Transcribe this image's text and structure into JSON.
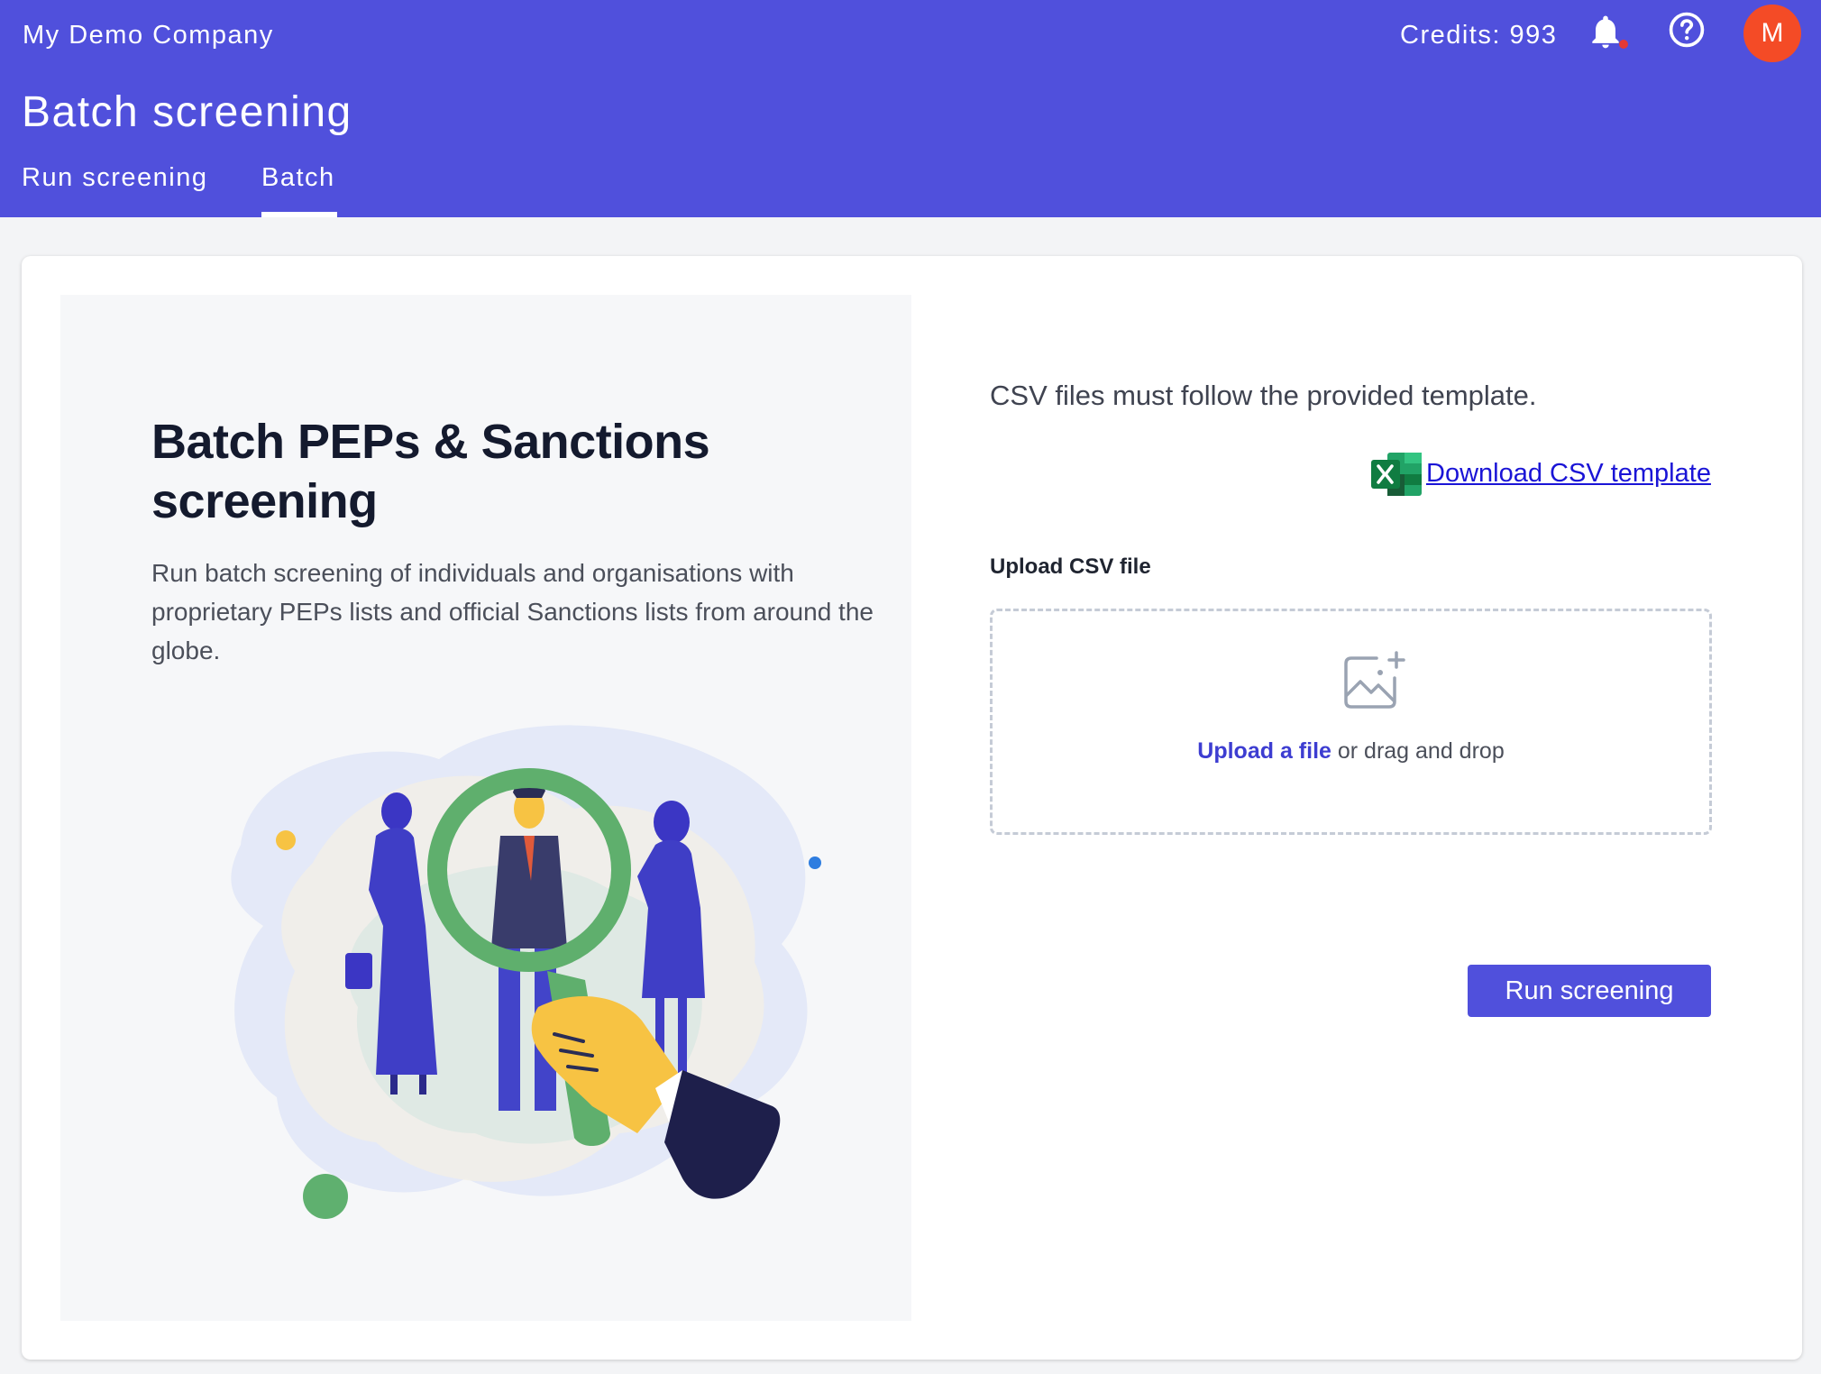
{
  "header": {
    "company": "My Demo Company",
    "credits": "Credits: 993",
    "avatar_initial": "M",
    "page_title": "Batch screening",
    "tabs": [
      {
        "label": "Run screening",
        "active": false
      },
      {
        "label": "Batch",
        "active": true
      }
    ],
    "background_color": "#5050dc",
    "avatar_color": "#f44b26"
  },
  "info": {
    "heading": "Batch PEPs & Sanctions screening",
    "description": "Run batch screening of individuals and organisations with proprietary PEPs lists and official Sanctions lists from around the globe."
  },
  "upload": {
    "csv_note": "CSV files must follow the provided template.",
    "download_label": "Download CSV template",
    "label": "Upload CSV file",
    "link_text": "Upload a file",
    "drag_text": " or drag and drop",
    "button_label": "Run screening"
  },
  "icons": {
    "notifications": "bell-icon",
    "help": "question-circle-icon",
    "template": "excel-icon",
    "dropzone": "image-plus-icon"
  }
}
